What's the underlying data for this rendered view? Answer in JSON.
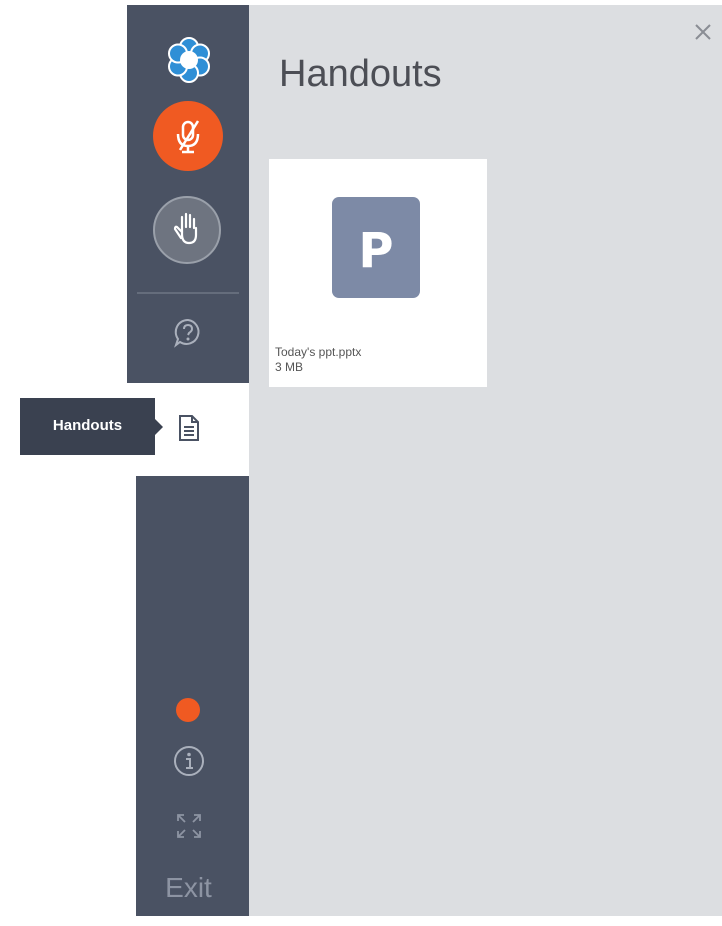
{
  "panel": {
    "title": "Handouts",
    "close_icon": "close-icon"
  },
  "files": [
    {
      "name": "Today's ppt.pptx",
      "size": "3 MB",
      "icon_letter": "P",
      "icon_color": "#7d8aa6"
    }
  ],
  "sidebar": {
    "logo_icon": "app-logo-icon",
    "mic_icon": "microphone-muted-icon",
    "hand_icon": "raise-hand-icon",
    "qa_icon": "question-chat-icon",
    "handouts_icon": "document-icon",
    "info_icon": "info-icon",
    "fullscreen_icon": "fullscreen-icon",
    "exit_label": "Exit"
  },
  "tooltip": {
    "label": "Handouts"
  },
  "colors": {
    "sidebar": "#4a5263",
    "accent": "#f05a22",
    "panel_bg": "#dcdee1",
    "logo": "#2f8fd6"
  }
}
